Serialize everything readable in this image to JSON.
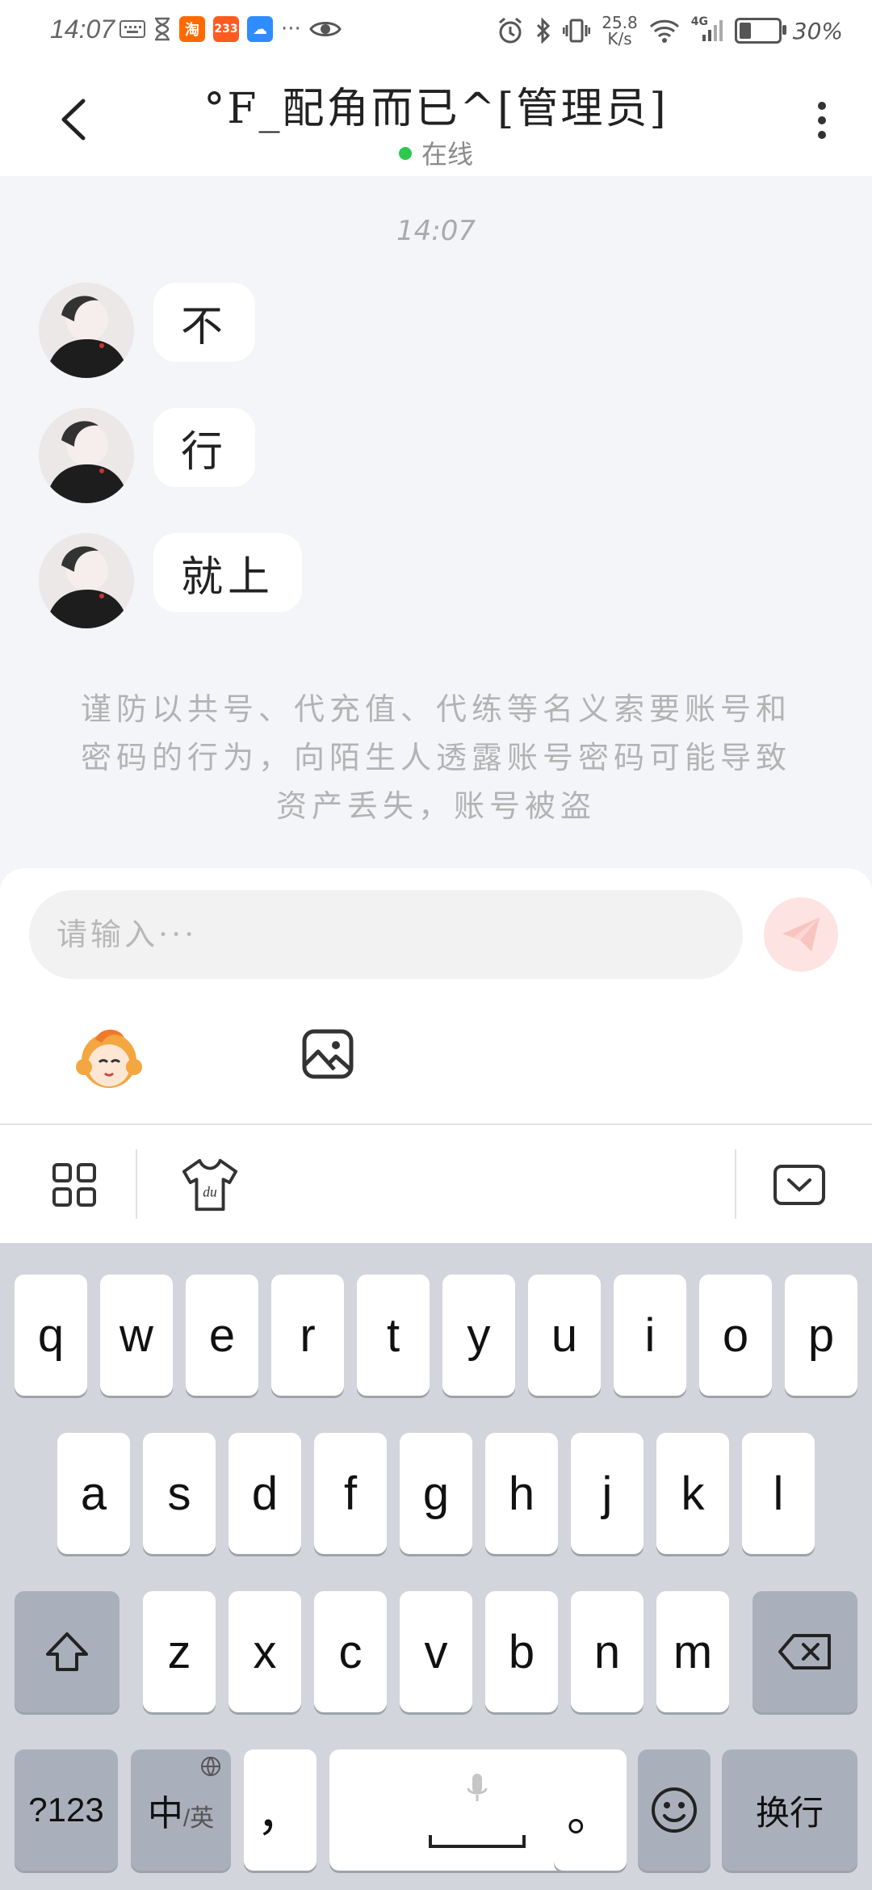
{
  "status_bar": {
    "time": "14:07",
    "app_badges": [
      {
        "label": "淘",
        "color": "#ff6a00"
      },
      {
        "label": "233",
        "color": "#ff5a1f"
      },
      {
        "label": "☁",
        "color": "#2f8cff"
      }
    ],
    "more": "···",
    "net_speed_value": "25.8",
    "net_speed_unit": "K/s",
    "network": "4G",
    "battery": "30%"
  },
  "header": {
    "title": "°F_配角而已^[管理员]",
    "status": "在线",
    "status_color": "#2dc84d"
  },
  "chat": {
    "timestamp": "14:07",
    "messages": [
      {
        "text": "不"
      },
      {
        "text": "行"
      },
      {
        "text": "就上"
      }
    ],
    "notice": "谨防以共号、代充值、代练等名义索要账号和密码的行为，向陌生人透露账号密码可能导致资产丢失，账号被盗"
  },
  "input": {
    "placeholder": "请输入···",
    "value": ""
  },
  "keyboard": {
    "row1": [
      "q",
      "w",
      "e",
      "r",
      "t",
      "y",
      "u",
      "i",
      "o",
      "p"
    ],
    "row2": [
      "a",
      "s",
      "d",
      "f",
      "g",
      "h",
      "j",
      "k",
      "l"
    ],
    "row3": [
      "z",
      "x",
      "c",
      "v",
      "b",
      "n",
      "m"
    ],
    "num_key": "?123",
    "lang_key_main": "中",
    "lang_key_sub": "/英",
    "comma_key": "，",
    "period_key": "。",
    "enter_key": "换行"
  },
  "icons": {
    "back": "chevron-left-icon",
    "more": "more-vertical-icon",
    "send": "paper-plane-icon",
    "emoji": "mascot-emoji-icon",
    "image": "image-icon",
    "grid": "grid-icon",
    "skin": "shirt-icon",
    "collapse": "keyboard-collapse-icon",
    "shift": "shift-icon",
    "backspace": "backspace-icon",
    "mic": "microphone-icon",
    "smiley": "smiley-icon",
    "globe": "globe-icon"
  }
}
